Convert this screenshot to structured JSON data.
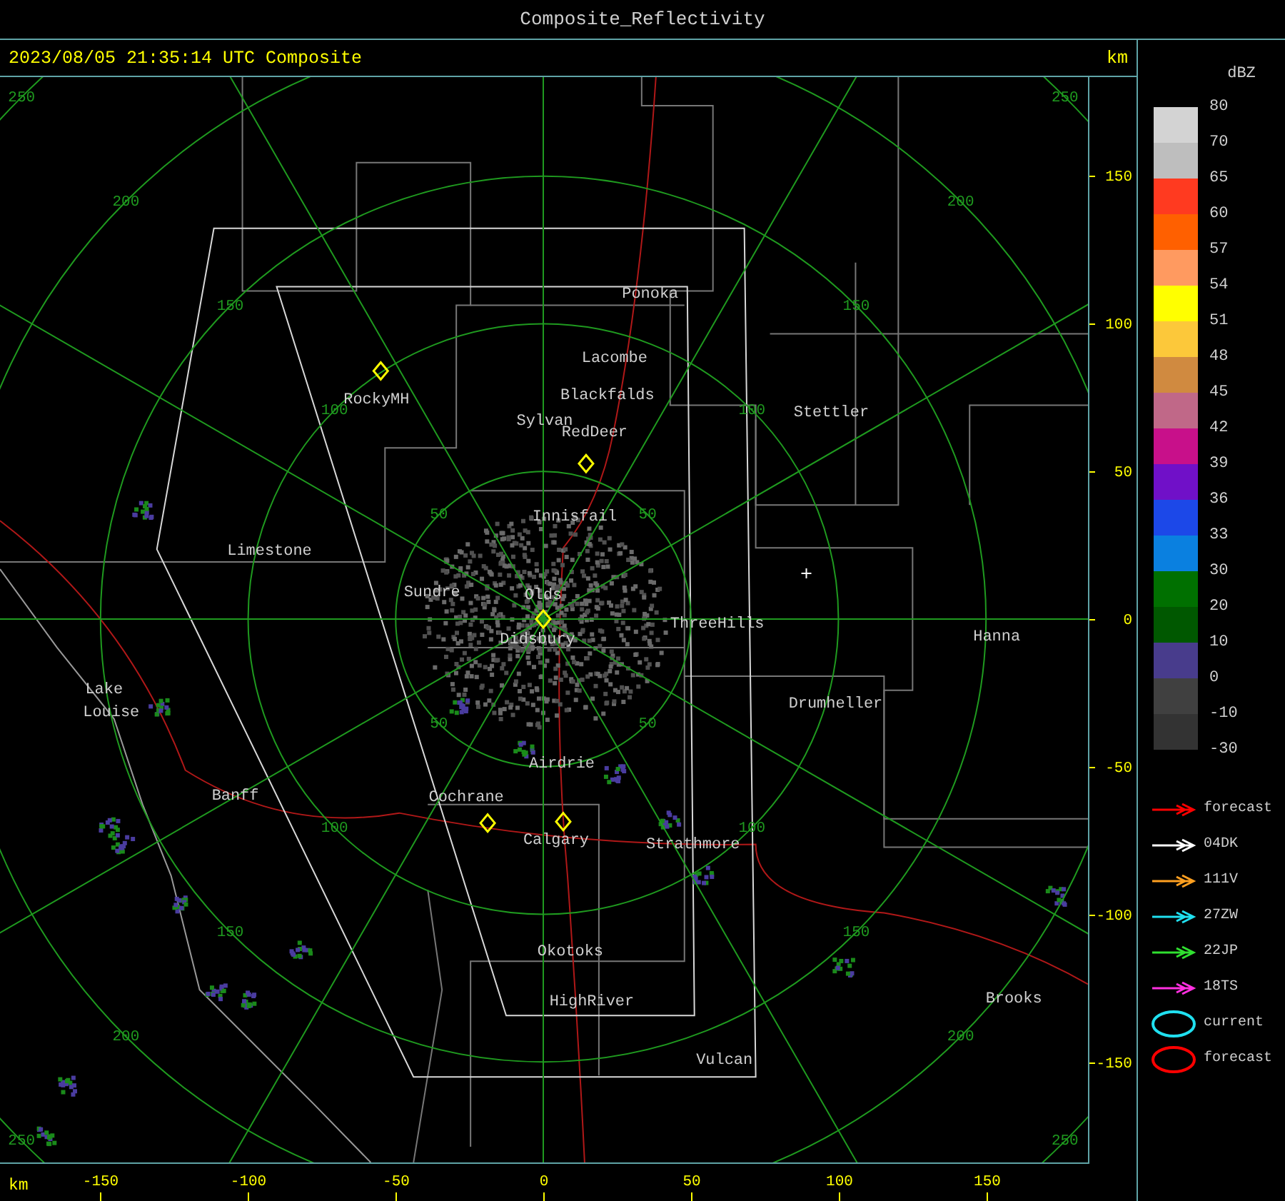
{
  "window": {
    "title": "Composite_Reflectivity"
  },
  "header": {
    "timestamp": "2023/08/05 21:35:14 UTC Composite",
    "unit": "km"
  },
  "map": {
    "rings": [
      {
        "labels": [
          "50",
          "50",
          "50",
          "50"
        ]
      },
      {
        "labels": [
          "100",
          "100",
          "100",
          "100"
        ]
      },
      {
        "labels": [
          "150",
          "150",
          "150",
          "150"
        ]
      },
      {
        "labels": [
          "200",
          "200",
          "200",
          "200"
        ]
      },
      {
        "labels": [
          "250",
          "250",
          "250",
          "250"
        ]
      }
    ],
    "places": [
      "Ponoka",
      "Lacombe",
      "Blackfalds",
      "Sylvan",
      "RedDeer",
      "RockyMH",
      "Stettler",
      "Innisfail",
      "Limestone",
      "Sundre",
      "Olds",
      "ThreeHills",
      "Didsbury",
      "Hanna",
      "Drumheller",
      "Lake",
      "Louise",
      "Banff",
      "Cochrane",
      "Airdrie",
      "Calgary",
      "Strathmore",
      "Okotoks",
      "HighRiver",
      "Brooks",
      "Vulcan"
    ],
    "y_axis": {
      "labels": [
        "150",
        "100",
        "50",
        "0",
        "-50",
        "-100",
        "-150"
      ]
    },
    "x_axis": {
      "unit": "km",
      "labels": [
        "-150",
        "-100",
        "-50",
        "0",
        "50",
        "100",
        "150"
      ]
    }
  },
  "legend": {
    "title": "dBZ",
    "swatches": [
      {
        "color": "#d3d3d3"
      },
      {
        "color": "#bebebe"
      },
      {
        "color": "#ff3a20"
      },
      {
        "color": "#ff6000"
      },
      {
        "color": "#ff9a60"
      },
      {
        "color": "#ffff00"
      },
      {
        "color": "#fcc83a"
      },
      {
        "color": "#d08a40"
      },
      {
        "color": "#c06888"
      },
      {
        "color": "#c8108a"
      },
      {
        "color": "#7010c8"
      },
      {
        "color": "#1c48e8"
      },
      {
        "color": "#0a80e0"
      },
      {
        "color": "#007000"
      },
      {
        "color": "#005800"
      },
      {
        "color": "#483c8c"
      },
      {
        "color": "#404040"
      },
      {
        "color": "#333333"
      }
    ],
    "values": [
      "80",
      "70",
      "65",
      "60",
      "57",
      "54",
      "51",
      "48",
      "45",
      "42",
      "39",
      "36",
      "33",
      "30",
      "20",
      "10",
      "0",
      "-10",
      "-30"
    ],
    "tracks": [
      {
        "kind": "arrow",
        "label": "forecast",
        "color": "#ff0000"
      },
      {
        "kind": "arrow",
        "label": "04DK",
        "color": "#ffffff"
      },
      {
        "kind": "arrow",
        "label": "111V",
        "color": "#ffa020"
      },
      {
        "kind": "arrow",
        "label": "27ZW",
        "color": "#20e0f0"
      },
      {
        "kind": "arrow",
        "label": "22JP",
        "color": "#30e030"
      },
      {
        "kind": "arrow",
        "label": "18TS",
        "color": "#ff30e0"
      },
      {
        "kind": "ellipse",
        "label": "current",
        "color": "#20e0f0"
      },
      {
        "kind": "ellipse",
        "label": "forecast",
        "color": "#ff0000"
      }
    ]
  }
}
